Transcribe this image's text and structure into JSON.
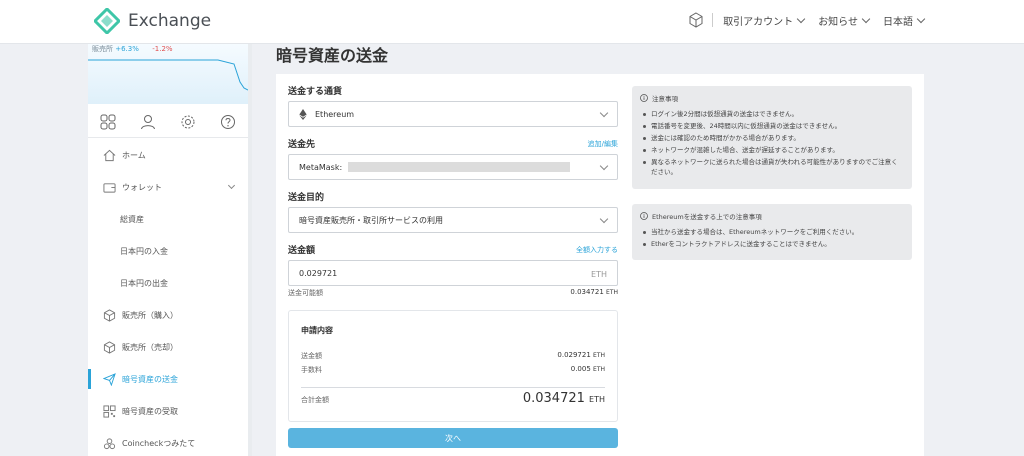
{
  "header": {
    "logo_text": "Exchange",
    "nav": [
      {
        "label": "取引アカウント"
      },
      {
        "label": "お知らせ"
      },
      {
        "label": "日本語"
      }
    ]
  },
  "sidebar": {
    "chart_label_1": "販売所",
    "chart_value_1": "+6.3%",
    "chart_label_2": "",
    "chart_value_2": "-1.2%",
    "menu": [
      {
        "label": "ホーム",
        "icon": "home-icon"
      },
      {
        "label": "ウォレット",
        "icon": "wallet-icon"
      },
      {
        "label": "総資産"
      },
      {
        "label": "日本円の入金"
      },
      {
        "label": "日本円の出金"
      },
      {
        "label": "販売所（購入）",
        "icon": "cube-icon"
      },
      {
        "label": "販売所（売却）",
        "icon": "cube-icon"
      },
      {
        "label": "暗号資産の送金",
        "icon": "send-icon"
      },
      {
        "label": "暗号資産の受取",
        "icon": "qr-icon"
      },
      {
        "label": "Coincheckつみたて",
        "icon": "coins-icon"
      }
    ]
  },
  "page": {
    "title": "暗号資産の送金"
  },
  "form": {
    "currency_label": "送金する通貨",
    "currency_value": "Ethereum",
    "dest_label": "送金先",
    "dest_link": "追加/編集",
    "dest_value": "MetaMask:",
    "purpose_label": "送金目的",
    "purpose_value": "暗号資産販売所・取引所サービスの利用",
    "amount_label": "送金額",
    "amount_link": "全額入力する",
    "amount_value": "0.029721",
    "amount_unit": "ETH",
    "available_label": "送金可能額",
    "available_value": "0.034721",
    "available_unit": "ETH"
  },
  "summary": {
    "title": "申請内容",
    "send_label": "送金額",
    "send_value": "0.029721",
    "fee_label": "手数料",
    "fee_value": "0.005",
    "total_label": "合計金額",
    "total_value": "0.034721",
    "unit": "ETH",
    "next_button": "次へ"
  },
  "notices": {
    "general": {
      "title": "注意事項",
      "items": [
        "ログイン後2分間は仮想通貨の送金はできません。",
        "電話番号を変更後、24時間以内に仮想通貨の送金はできません。",
        "送金には確認のため時間がかかる場合があります。",
        "ネットワークが混雑した場合、送金が遅延することがあります。",
        "異なるネットワークに送られた場合は通貨が失われる可能性がありますのでご注意ください。"
      ]
    },
    "ethereum": {
      "title": "Ethereumを送金する上での注意事項",
      "items": [
        "当社から送金する場合は、Ethereumネットワークをご利用ください。",
        "Etherをコントラクトアドレスに送金することはできません。"
      ]
    }
  },
  "colors": {
    "accent": "#2aa3d8",
    "button": "#5ab4df",
    "logo": "#3ec6a8"
  }
}
